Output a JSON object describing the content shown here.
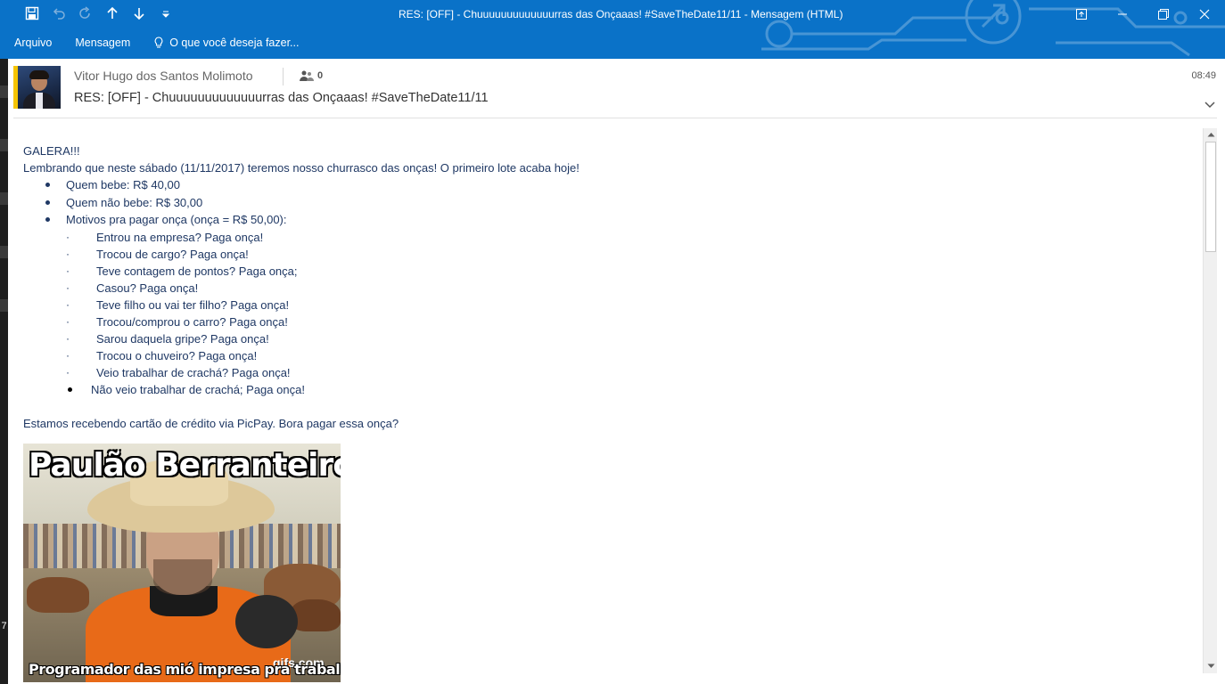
{
  "window": {
    "title": "RES: [OFF] - Chuuuuuuuuuuuuurras das Onçaaas! #SaveTheDate11/11  - Mensagem (HTML)",
    "accent": "#0a72c8"
  },
  "quick_access": [
    "save-icon",
    "undo-icon",
    "redo-icon",
    "previous-item-icon",
    "next-item-icon",
    "customize-qat-icon"
  ],
  "ribbon": {
    "tabs": [
      "Arquivo",
      "Mensagem"
    ],
    "tell_me": "O que você deseja fazer..."
  },
  "side": {
    "left_number": "7"
  },
  "header": {
    "sender": "Vitor Hugo dos Santos Molimoto",
    "people_count": "0",
    "time": "08:49",
    "subject": "RES: [OFF] - Chuuuuuuuuuuuuurras das Onçaaas! #SaveTheDate11/11"
  },
  "message": {
    "greeting": "GALERA!!!",
    "intro": "Lembrando que neste sábado (11/11/2017) teremos nosso churrasco das onças! O primeiro lote acaba hoje!",
    "bullets": [
      "Quem bebe: R$ 40,00",
      "Quem não bebe: R$ 30,00",
      "Motivos pra pagar onça (onça = R$ 50,00):"
    ],
    "sub_marker": "·",
    "reasons": [
      "Entrou na empresa? Paga onça!",
      "Trocou de cargo? Paga onça!",
      "Teve contagem de pontos? Paga onça;",
      "Casou? Paga onça!",
      "Teve filho ou vai ter filho? Paga onça!",
      "Trocou/comprou o carro? Paga onça!",
      "Sarou daquela gripe? Paga onça!",
      "Trocou o chuveiro? Paga onça!",
      "Veio trabalhar de crachá? Paga onça!"
    ],
    "last_reason": "Não veio trabalhar de crachá; Paga onça!",
    "closing": "Estamos recebendo cartão de crédito via PicPay. Bora pagar essa onça?",
    "gif": {
      "caption_top": "Paulão Berranteiro",
      "caption_bottom": "Programador das mió impresa pra trabalha",
      "watermark": "gifs.com"
    }
  }
}
